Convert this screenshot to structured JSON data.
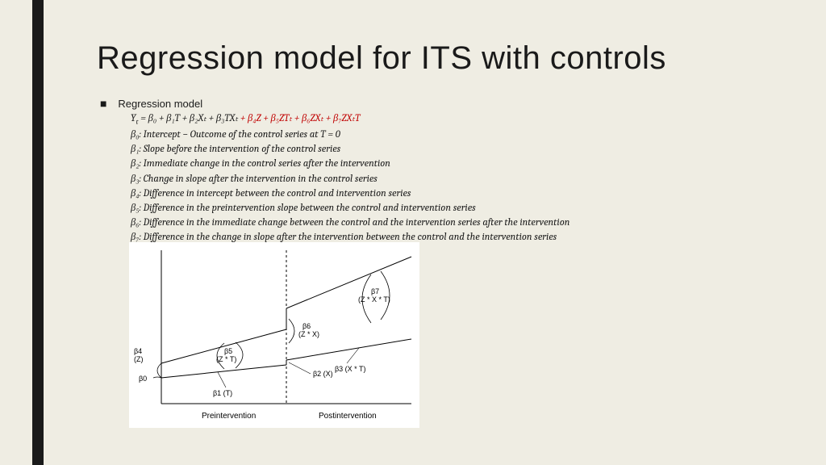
{
  "title": "Regression model for ITS with controls",
  "bullet": "Regression model",
  "equation": {
    "lhs": "Y",
    "lhs_sub": "t",
    "black": " = β₀ + β₁T + β₂Xₜ + β₃TXₜ",
    "red": " + β₄Z + β₅ZTₜ + β₆ZXₜ + β₇ZXₜT"
  },
  "betas": [
    {
      "sym": "β₀",
      "desc": "Intercept  − Outcome of the control series at T = 0"
    },
    {
      "sym": "β₁",
      "desc": "Slope before the intervention of the control series"
    },
    {
      "sym": "β₂",
      "desc": "Immediate change in the control series after the intervention"
    },
    {
      "sym": "β₃",
      "desc": "Change in slope after the intervention in the control series"
    },
    {
      "sym": "β₄",
      "desc": "Difference in intercept between the control and intervention series"
    },
    {
      "sym": "β₅",
      "desc": "Difference in the preintervention slope between the control and intervention series"
    },
    {
      "sym": "β₆",
      "desc": "Difference in the immediate change between the control and the intervention series  after the intervention"
    },
    {
      "sym": "β₇",
      "desc": "Difference in the change in slope after the intervention between the control and the intervention series"
    }
  ],
  "chart_data": {
    "type": "line",
    "x_break": 0.5,
    "x_axis_periods": [
      "Preintervention",
      "Postintervention"
    ],
    "control": {
      "intercept_b0": 0.18,
      "slope_b1": 0.1,
      "step_b2": 0.03,
      "slope_change_b3": 0.06
    },
    "intervention_deltas": {
      "d_intercept_b4": 0.1,
      "d_slope_b5": 0.18,
      "d_step_b6": 0.12,
      "d_slope_change_b7": 0.3
    },
    "labels": {
      "b0": "β0",
      "b1": "β1 (T)",
      "b2": "β2 (X)",
      "b3": "β3 (X * T)",
      "b4": "β4\n(Z)",
      "b5": "β5\n(Z * T)",
      "b6": "β6\n(Z * X)",
      "b7": "β7\n(Z * X * T)"
    }
  }
}
